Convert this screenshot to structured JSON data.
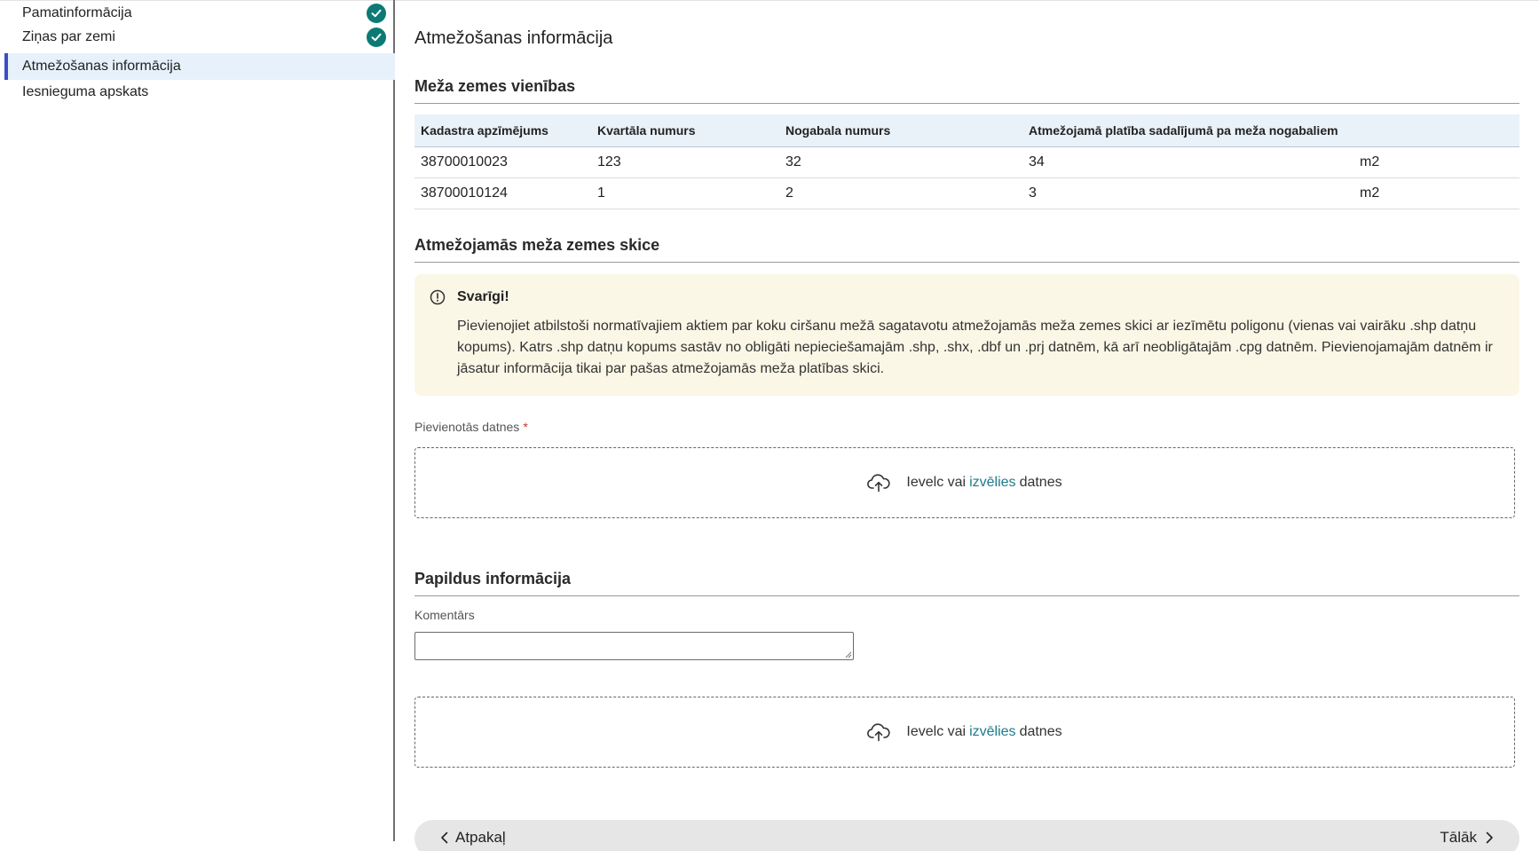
{
  "sidebar": {
    "items": [
      {
        "label": "Pamatinformācija",
        "completed": true
      },
      {
        "label": "Ziņas par zemi",
        "completed": true
      },
      {
        "label": "Atmežošanas informācija",
        "active": true
      },
      {
        "label": "Iesnieguma apskats"
      }
    ]
  },
  "main": {
    "title": "Atmežošanas informācija",
    "units_section": {
      "title": "Meža zemes vienības",
      "columns": [
        "Kadastra apzīmējums",
        "Kvartāla numurs",
        "Nogabala numurs",
        "Atmežojamā platība sadalījumā pa meža nogabaliem",
        ""
      ],
      "rows": [
        [
          "38700010023",
          "123",
          "32",
          "34",
          "m2"
        ],
        [
          "38700010124",
          "1",
          "2",
          "3",
          "m2"
        ]
      ]
    },
    "sketch_section": {
      "title": "Atmežojamās meža zemes skice",
      "alert_title": "Svarīgi!",
      "alert_text": "Pievienojiet atbilstoši normatīvajiem aktiem par koku ciršanu mežā sagatavotu atmežojamās meža zemes skici ar iezīmētu poligonu (vienas vai vairāku .shp datņu kopums). Katrs .shp datņu kopums sastāv no obligāti nepieciešamajām .shp, .shx, .dbf un .prj datnēm, kā arī neobligātajām .cpg datnēm. Pievienojamajām datnēm ir jāsatur informācija tikai par pašas atmežojamās meža platības skici.",
      "files_label": "Pievienotās datnes",
      "required_mark": "*"
    },
    "dropzone": {
      "prefix": "Ievelc vai",
      "link": "izvēlies",
      "suffix": "datnes"
    },
    "extra_section": {
      "title": "Papildus informācija",
      "comment_label": "Komentārs",
      "comment_value": ""
    },
    "footer": {
      "back_label": "Atpakaļ",
      "next_label": "Tālāk"
    }
  },
  "colors": {
    "accent": "#3b4ec8",
    "check": "#0c7a74",
    "link": "#1f7a8c",
    "alert_bg": "#fbf7e6",
    "table_header_bg": "#e9f1f9",
    "active_bg": "#e6f1fb"
  },
  "icons": [
    "check-icon",
    "alert-icon",
    "upload-cloud-icon",
    "chevron-left-icon",
    "chevron-right-icon"
  ]
}
